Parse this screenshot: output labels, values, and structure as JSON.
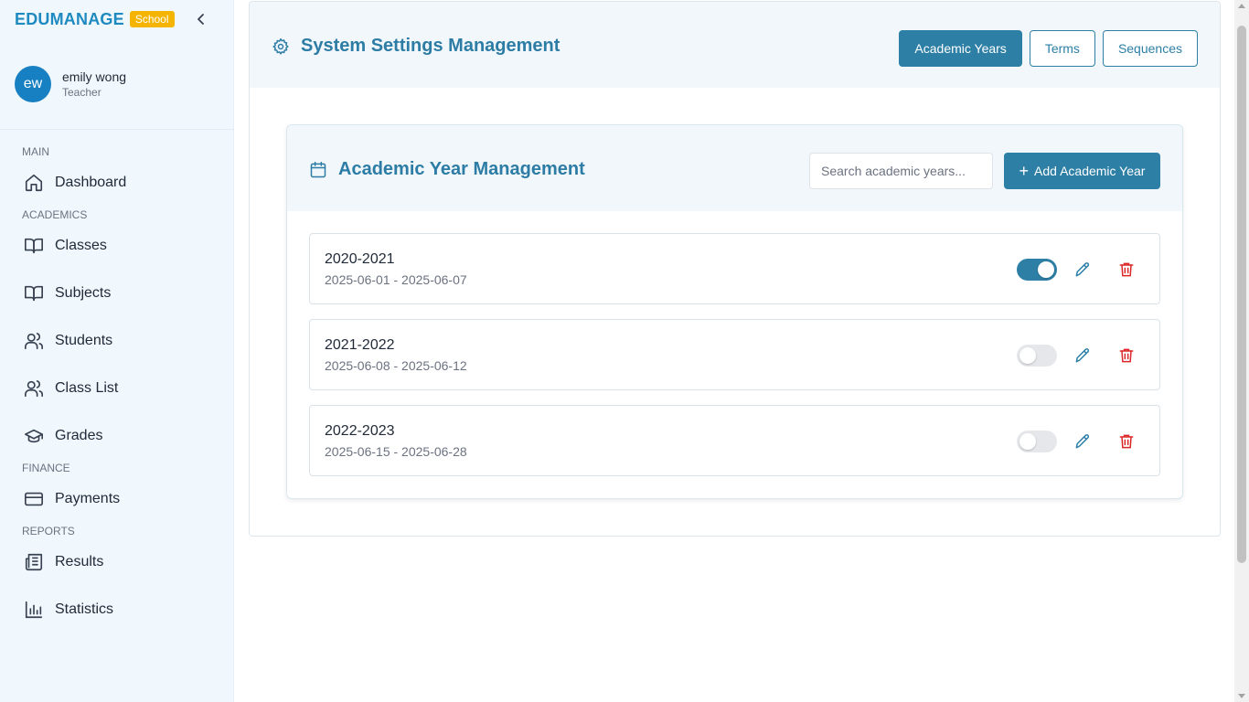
{
  "sidebar": {
    "brand": "EDUMANAGE",
    "badge": "School",
    "user": {
      "initials": "ew",
      "name": "emily wong",
      "role": "Teacher"
    },
    "sections": {
      "main": "MAIN",
      "academics": "ACADEMICS",
      "finance": "FINANCE",
      "reports": "REPORTS"
    },
    "items": {
      "dashboard": "Dashboard",
      "classes": "Classes",
      "subjects": "Subjects",
      "students": "Students",
      "class_list": "Class List",
      "grades": "Grades",
      "payments": "Payments",
      "results": "Results",
      "statistics": "Statistics"
    }
  },
  "header": {
    "title": "System Settings Management",
    "tabs": [
      "Academic Years",
      "Terms",
      "Sequences"
    ],
    "active_tab": "Academic Years"
  },
  "academic_years": {
    "title": "Academic Year Management",
    "search_placeholder": "Search academic years...",
    "add_button": "Add Academic Year",
    "rows": [
      {
        "name": "2020-2021",
        "dates": "2025-06-01 - 2025-06-07",
        "active": true
      },
      {
        "name": "2021-2022",
        "dates": "2025-06-08 - 2025-06-12",
        "active": false
      },
      {
        "name": "2022-2023",
        "dates": "2025-06-15 - 2025-06-28",
        "active": false
      }
    ]
  },
  "colors": {
    "brand": "#1f8ac0",
    "badge": "#f4b400",
    "primary": "#2d7fa6",
    "danger": "#dc2626"
  }
}
